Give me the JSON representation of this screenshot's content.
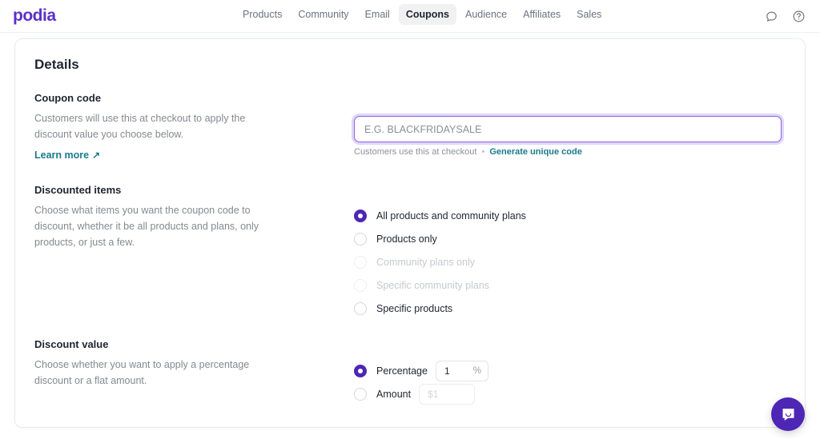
{
  "header": {
    "logo": "podia",
    "nav": [
      {
        "label": "Products",
        "active": false
      },
      {
        "label": "Community",
        "active": false
      },
      {
        "label": "Email",
        "active": false
      },
      {
        "label": "Coupons",
        "active": true
      },
      {
        "label": "Audience",
        "active": false
      },
      {
        "label": "Affiliates",
        "active": false
      },
      {
        "label": "Sales",
        "active": false
      }
    ],
    "icons": [
      {
        "name": "chat-bubble-icon"
      },
      {
        "name": "help-circle-icon"
      }
    ]
  },
  "card": {
    "title": "Details"
  },
  "coupon_code": {
    "heading": "Coupon code",
    "description": "Customers will use this at checkout to apply the discount value you choose below.",
    "learn_more": "Learn more",
    "learn_more_arrow": "↗",
    "input_value": "",
    "input_placeholder": "E.G. BLACKFRIDAYSALE",
    "help_text": "Customers use this at checkout",
    "help_separator": "•",
    "generate_link": "Generate unique code"
  },
  "discounted_items": {
    "heading": "Discounted items",
    "description": "Choose what items you want the coupon code to discount, whether it be all products and plans, only products, or just a few.",
    "options": [
      {
        "label": "All products and community plans",
        "selected": true,
        "disabled": false
      },
      {
        "label": "Products only",
        "selected": false,
        "disabled": false
      },
      {
        "label": "Community plans only",
        "selected": false,
        "disabled": true
      },
      {
        "label": "Specific community plans",
        "selected": false,
        "disabled": true
      },
      {
        "label": "Specific products",
        "selected": false,
        "disabled": false
      }
    ]
  },
  "discount_value": {
    "heading": "Discount value",
    "description": "Choose whether you want to apply a percentage discount or a flat amount.",
    "percentage": {
      "label": "Percentage",
      "selected": true,
      "value": "1",
      "suffix": "%"
    },
    "amount": {
      "label": "Amount",
      "selected": false,
      "value": "",
      "placeholder": "$1"
    }
  },
  "chat": {
    "name": "chat-launcher"
  },
  "colors": {
    "brand_purple": "#5a31c9",
    "radio_purple": "#4d26b5",
    "link_teal": "#1a7b8c",
    "focus_ring": "#8b63e8"
  }
}
